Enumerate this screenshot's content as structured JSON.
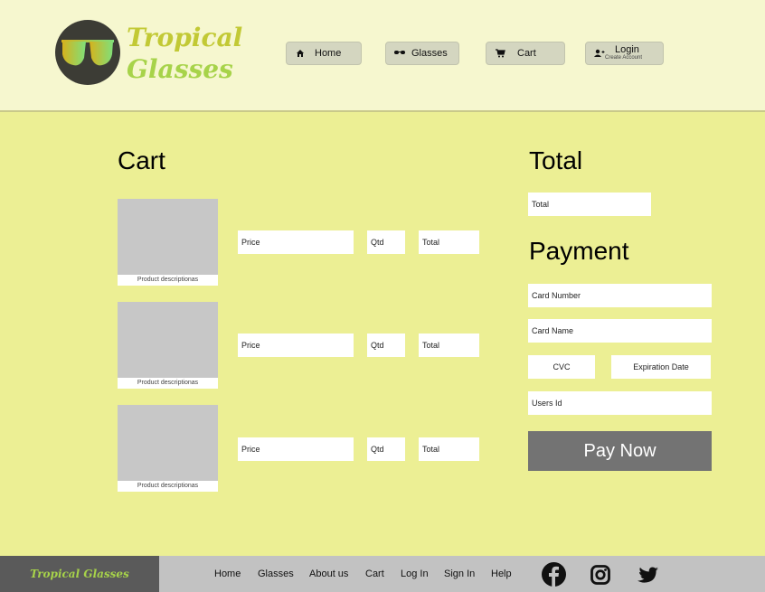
{
  "header": {
    "brand_line1": "Tropical",
    "brand_line2": "Glasses",
    "logo_icon": "sunglasses-icon",
    "nav": {
      "home": "Home",
      "glasses": "Glasses",
      "cart": "Cart",
      "login": "Login",
      "login_sub": "Create Account"
    }
  },
  "cart": {
    "title": "Cart",
    "items": [
      {
        "description": "Product descriptionas",
        "price": "Price",
        "qty": "Qtd",
        "total": "Total"
      },
      {
        "description": "Product descriptionas",
        "price": "Price",
        "qty": "Qtd",
        "total": "Total"
      },
      {
        "description": "Product descriptionas",
        "price": "Price",
        "qty": "Qtd",
        "total": "Total"
      }
    ]
  },
  "summary": {
    "total_title": "Total",
    "total_field": "Total",
    "payment_title": "Payment",
    "card_number": "Card Number",
    "card_name": "Card Name",
    "cvc": "CVC",
    "expiration": "Expiration Date",
    "users_id": "Users Id",
    "pay_button": "Pay Now"
  },
  "footer": {
    "brand": "Tropical Glasses",
    "links": [
      "Home",
      "Glasses",
      "About us",
      "Cart",
      "Log In",
      "Sign In",
      "Help"
    ],
    "social": [
      "facebook-icon",
      "instagram-icon",
      "twitter-icon"
    ]
  },
  "colors": {
    "page_bg": "#ecef94",
    "header_bg": "#f6f7cf",
    "button_bg": "#737373",
    "footer_bg": "#c2c2c2"
  }
}
